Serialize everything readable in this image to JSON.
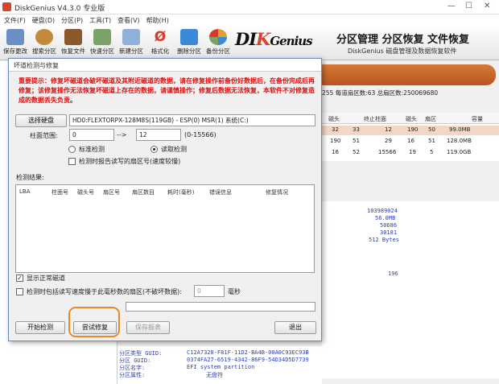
{
  "window": {
    "title": "DiskGenius V4.3.0 专业版"
  },
  "menu": [
    "文件(F)",
    "硬盘(D)",
    "分区(P)",
    "工具(T)",
    "查看(V)",
    "帮助(H)"
  ],
  "toolbar": [
    {
      "label": "保存更改",
      "icon": "save-icon",
      "color": "#6a8fc7"
    },
    {
      "label": "搜索分区",
      "icon": "search-icon",
      "color": "#c08a3a"
    },
    {
      "label": "恢复文件",
      "icon": "recover-icon",
      "color": "#8a5a2a"
    },
    {
      "label": "快速分区",
      "icon": "quick-partition-icon",
      "color": "#7aa36a"
    },
    {
      "label": "新建分区",
      "icon": "new-partition-icon",
      "color": "#8fb0d8"
    },
    {
      "label": "格式化",
      "icon": "format-icon",
      "color": "#d83a2a"
    },
    {
      "label": "删除分区",
      "icon": "delete-icon",
      "color": "#3a8ad8"
    },
    {
      "label": "备份分区",
      "icon": "backup-icon",
      "color": "#e0a030"
    }
  ],
  "brand": {
    "logo_a": "DI",
    "logo_k": "K",
    "logo_b": "Genius",
    "slogan": "分区管理 分区恢复 文件恢复",
    "subslogan": "DiskGenius 磁盘管理及数据恢复软件"
  },
  "disk_info": "255  每道扇区数:63  总扇区数:250069680",
  "partition_table": {
    "headers": [
      "磁头",
      "终止柱面",
      "磁头",
      "扇区",
      "容量"
    ],
    "rows": [
      [
        "32",
        "33",
        "12",
        "190",
        "50",
        "99.0MB"
      ],
      [
        "190",
        "51",
        "29",
        "16",
        "51",
        "128.0MB"
      ],
      [
        "16",
        "52",
        "15566",
        "19",
        "5",
        "119.0GB"
      ]
    ]
  },
  "details": [
    "103989024",
    "56.0MB",
    "50686",
    "30181",
    "512 Bytes",
    "196"
  ],
  "bottom_info": [
    {
      "label": "分区类型 GUID:",
      "value": "C12A7328-F81F-11D2-BA4B-00A0C93EC93B"
    },
    {
      "label": "分区 GUID:",
      "value": "0374FA27-6519-4342-86F9-54D34D5D7739"
    },
    {
      "label": "分区名字:",
      "value": "EFI system partition"
    },
    {
      "label": "分区属性:",
      "value": "无盘符"
    }
  ],
  "dialog": {
    "title": "坏道检测与修复",
    "warning": "重要提示：修复坏磁道会破坏磁道及其附近磁道的数据，请在修复操作前备份好数据后，在备份完成后再修复；该修复操作无法恢复坏磁道上存在的数据，请谨慎操作；修复后数据无法恢复，本软件不对修复造成的数据丢失负责。",
    "select_disk_button": "选择硬盘",
    "disk_label": "HD0:FLEXTORPX-128M8S(119GB) - ESP(0) MSR(1) 系统(C:)",
    "cyl_range_label": "柱面范围:",
    "cyl_from": "0",
    "cyl_arrow": "-->",
    "cyl_to": "12",
    "cyl_hint": "(0-15566)",
    "mode_standard": "标准检测",
    "mode_read": "读取检测",
    "report_check": "检测时报告读写的扇区号(速度较慢)",
    "results_label": "检测结果:",
    "result_headers": [
      "LBA",
      "柱面号",
      "磁头号",
      "扇区号",
      "扇区数目",
      "耗时(毫秒)",
      "错误信息",
      "修复情况"
    ],
    "show_normal": "显示正常磁道",
    "slow_check": "检测时包括读写速度慢于此毫秒数的扇区(不破坏数据):",
    "ms_value": "0",
    "ms_unit": "毫秒",
    "start_button": "开始检测",
    "repair_button": "尝试修复",
    "save_button": "保存报表",
    "exit_button": "退出"
  }
}
